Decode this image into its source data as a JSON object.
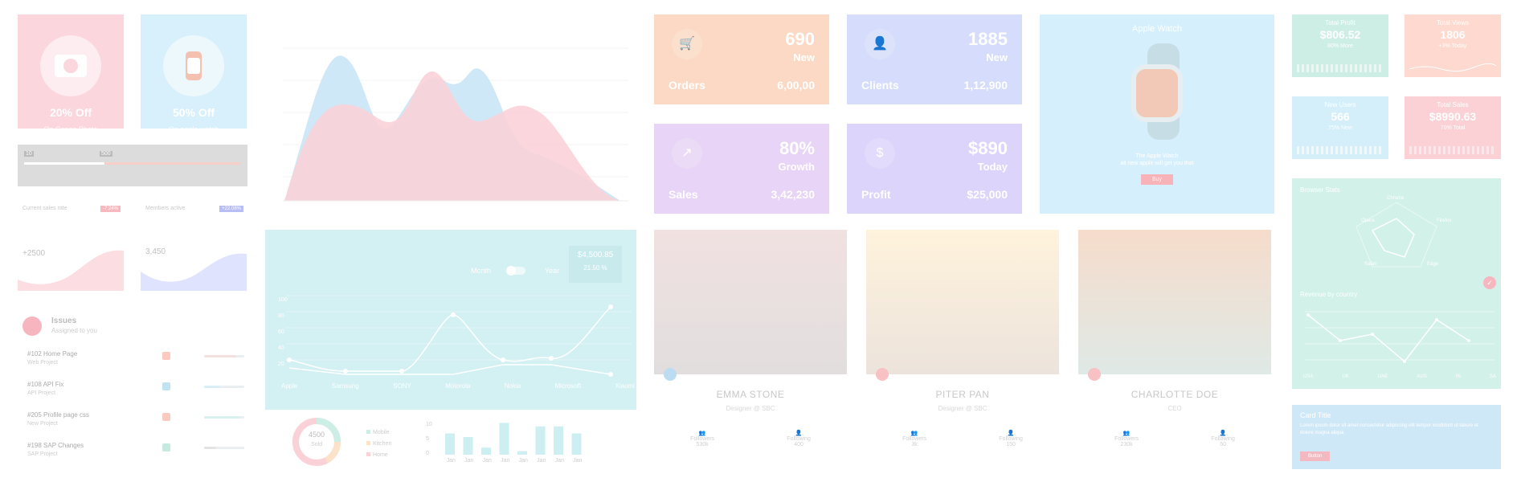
{
  "promos": [
    {
      "off": "20% Off",
      "sub": "On Canon Photo",
      "color": "#fbd6dd",
      "icon": "camera-icon"
    },
    {
      "off": "50% Off",
      "sub": "On apple watch",
      "color": "#d8f0fb",
      "icon": "watch-icon"
    }
  ],
  "slider": {
    "v1": "10",
    "v2": "500",
    "bg": "#8c8c8c",
    "fill": "#f5b7b1"
  },
  "cards_small": [
    {
      "title": "Current sales rate",
      "tag": "-7.24%",
      "value": "+2500",
      "color": "#fde0e4",
      "tagColor": "#f48b95"
    },
    {
      "title": "Members active",
      "tag": "+22.08%",
      "value": "3,450",
      "color": "#e2e6fd",
      "tagColor": "#8891f0"
    }
  ],
  "issues": {
    "title": "Issues",
    "subtitle": "Assigned to you",
    "items": [
      {
        "id": "#102 Home Page",
        "project": "Web Project",
        "color": "#f7a08e",
        "bar": 0.8
      },
      {
        "id": "#108 API Fix",
        "project": "API Project",
        "color": "#7ec7e8",
        "bar": 0.4
      },
      {
        "id": "#205 Profile page css",
        "project": "New Project",
        "color": "#f7a08e",
        "bar": 0.9
      },
      {
        "id": "#198 SAP Changes",
        "project": "SAP Project",
        "color": "#8fd6c4",
        "bar": 0.3
      }
    ]
  },
  "area_chart": {
    "colors": [
      "#c9e6f7",
      "#fbd1d8"
    ]
  },
  "line_panel": {
    "toggle_month": "Month",
    "toggle_year": "Year",
    "amount": "$4,500.85",
    "change": "21.50 %",
    "yticks": [
      "0",
      "20",
      "40",
      "60",
      "80",
      "100"
    ],
    "xlabels": [
      "Apple",
      "Samsung",
      "SONY",
      "Motorola",
      "Nokia",
      "Microsoft",
      "Xiaomi"
    ],
    "bg": "#d3f0f2"
  },
  "donut": {
    "value": "4500",
    "label": "Sold",
    "legend": [
      "Mobile",
      "Kitchen",
      "Home"
    ]
  },
  "bars": {
    "yticks": [
      "10",
      "5",
      "0"
    ],
    "labels": [
      "Jan",
      "Jan",
      "Jan",
      "Jan",
      "Jan",
      "Jan",
      "Jan",
      "Jan"
    ],
    "values": [
      6,
      5,
      2,
      9,
      1,
      8,
      8,
      6
    ]
  },
  "stats": [
    {
      "big": "690",
      "tag": "New",
      "lbl": "Orders",
      "val": "6,00,00",
      "color": "#fcd9c4",
      "icon": "cart-icon"
    },
    {
      "big": "1885",
      "tag": "New",
      "lbl": "Clients",
      "val": "1,12,900",
      "color": "#d6dcfb",
      "icon": "user-icon"
    },
    {
      "big": "80%",
      "tag": "Growth",
      "lbl": "Sales",
      "val": "3,42,230",
      "color": "#e7d4f6",
      "icon": "trend-icon"
    },
    {
      "big": "$890",
      "tag": "Today",
      "lbl": "Profit",
      "val": "$25,000",
      "color": "#dcd4fb",
      "icon": "dollar-icon"
    }
  ],
  "watch_card": {
    "title": "Apple Watch",
    "desc1": "The Apple Watch",
    "desc2": "all new apple will get you that",
    "button": "Buy",
    "color": "#d6effc"
  },
  "profiles": [
    {
      "name": "EMMA STONE",
      "role": "Designer @ SBC",
      "followers_label": "Followers",
      "followers": "530k",
      "following_label": "Following",
      "following": "400",
      "img": "#e8d6d6",
      "accent": "#9fc6e8"
    },
    {
      "name": "PITER PAN",
      "role": "Designer @ SBC",
      "followers_label": "Followers",
      "followers": "3k",
      "following_label": "Following",
      "following": "150",
      "img": "#fdefd6",
      "accent": "#f6a6a8"
    },
    {
      "name": "CHARLOTTE DOE",
      "role": "CEO",
      "followers_label": "Followers",
      "followers": "230k",
      "following_label": "Following",
      "following": "50",
      "img": "#f3d9c8",
      "accent": "#f6a6a8"
    }
  ],
  "minis": [
    {
      "t": "Total Profit",
      "v": "$806.52",
      "d": "80% More",
      "color": "#cdeee4"
    },
    {
      "t": "Total Views",
      "v": "1806",
      "d": "+3% Today",
      "color": "#fdd9cf"
    },
    {
      "t": "New Users",
      "v": "566",
      "d": "75% New",
      "color": "#d4effa"
    },
    {
      "t": "Total Sales",
      "v": "$8990.63",
      "d": "70% Total",
      "color": "#fbd1d6"
    }
  ],
  "radar": {
    "title": "Browser Stats",
    "labels": [
      "Chrome",
      "Opera",
      "Firefox",
      "Safari",
      "Edge"
    ],
    "color": "#d2f1e8"
  },
  "revenue": {
    "title": "Revenue by country",
    "labels": [
      "USA",
      "UK",
      "UAE",
      "AUS",
      "IN",
      "SA"
    ]
  },
  "card_title": {
    "title": "Card Title",
    "text": "Lorem ipsum dolor sit amet consectetur adipiscing elit tempor incididunt ut labore et dolore magna aliqua.",
    "button": "Button",
    "color": "#cfe8f7"
  }
}
